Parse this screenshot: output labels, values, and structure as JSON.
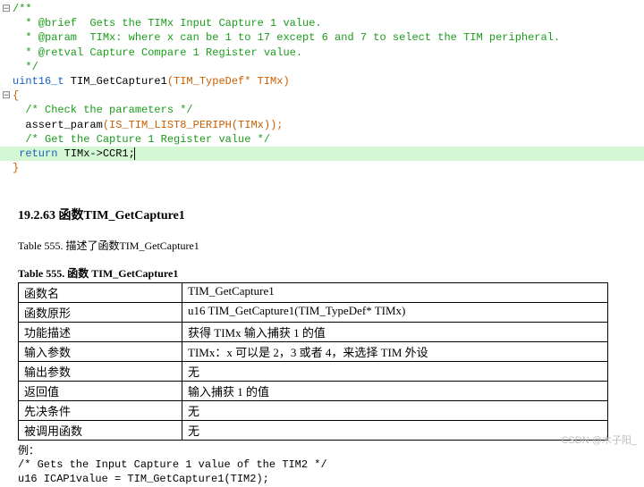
{
  "code": {
    "l1_marker": "⊟",
    "l1": "/**",
    "l2": "  * @brief  Gets the TIMx Input Capture 1 value.",
    "l3": "  * @param  TIMx: where x can be 1 to 17 except 6 and 7 to select the TIM peripheral.",
    "l4": "  * @retval Capture Compare 1 Register value.",
    "l5": "  */",
    "l6_type": "uint16_t",
    "l6_fn": " TIM_GetCapture1",
    "l6_args": "(TIM_TypeDef* TIMx)",
    "l7_marker": "⊟",
    "l7": "{",
    "l8": "  /* Check the parameters */",
    "l9_a": "  assert_param",
    "l9_b": "(IS_TIM_LIST8_PERIPH",
    "l9_c": "(TIMx));",
    "l10": "  /* Get the Capture 1 Register value */",
    "l11_kw": "  return",
    "l11_rest": " TIMx->CCR1;",
    "l12": "}"
  },
  "doc": {
    "heading": "19.2.63 函数TIM_GetCapture1",
    "caption_small": "Table 555. 描述了函数TIM_GetCapture1",
    "caption_strong": "Table 555. 函数 TIM_GetCapture1",
    "rows": [
      {
        "label": "函数名",
        "value": "TIM_GetCapture1"
      },
      {
        "label": "函数原形",
        "value": "u16 TIM_GetCapture1(TIM_TypeDef* TIMx)"
      },
      {
        "label": "功能描述",
        "value": "获得 TIMx 输入捕获 1 的值"
      },
      {
        "label": "输入参数",
        "value": "TIMx：x 可以是 2，3 或者 4，来选择 TIM 外设"
      },
      {
        "label": "输出参数",
        "value": "无"
      },
      {
        "label": "返回值",
        "value": "输入捕获 1 的值"
      },
      {
        "label": "先决条件",
        "value": "无"
      },
      {
        "label": "被调用函数",
        "value": "无"
      }
    ],
    "ex_label": "例：",
    "ex_l1": "/* Gets the Input Capture 1 value of the TIM2 */",
    "ex_l2": "u16 ICAP1value = TIM_GetCapture1(TIM2);"
  },
  "watermark": "CSDN @木子阳_"
}
